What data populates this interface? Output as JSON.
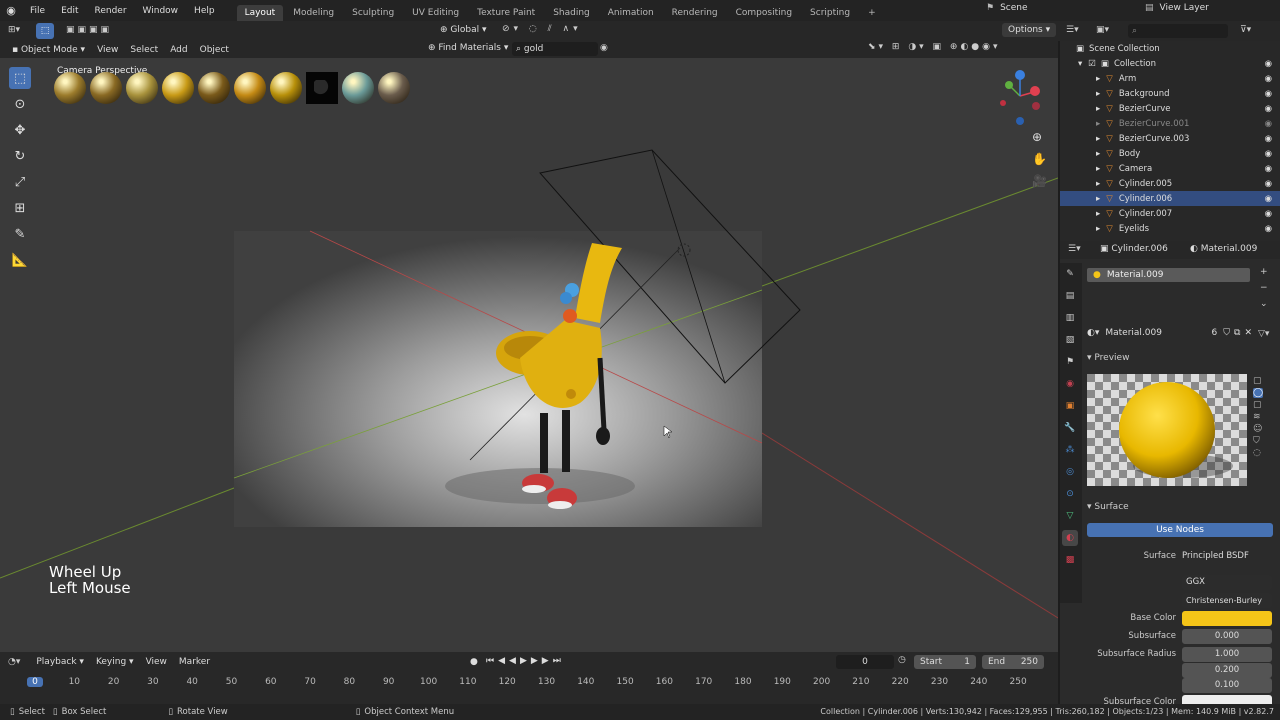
{
  "topbar": {
    "menus": [
      "File",
      "Edit",
      "Render",
      "Window",
      "Help"
    ],
    "tabs": [
      "Layout",
      "Modeling",
      "Sculpting",
      "UV Editing",
      "Texture Paint",
      "Shading",
      "Animation",
      "Rendering",
      "Compositing",
      "Scripting",
      "+"
    ],
    "scene": "Scene",
    "view_layer": "View Layer"
  },
  "viewport_header": {
    "mode": "Object Mode",
    "view": "View",
    "select": "Select",
    "add": "Add",
    "object": "Object",
    "orientation": "Global",
    "options": "Options",
    "find_materials": "Find Materials",
    "search_value": "gold"
  },
  "viewport": {
    "camera_label": "Camera Perspective",
    "overlay_line1": "Wheel Up",
    "overlay_line2": "Left Mouse",
    "material_colors": [
      "#9c7c2c",
      "#8a6a24",
      "#a8923c",
      "#c89a16",
      "#7a5a1a",
      "#c48a14",
      "#b8900a",
      "#101010",
      "#6a9a98",
      "#6a5c4c"
    ]
  },
  "outliner": {
    "scene_collection": "Scene Collection",
    "collection": "Collection",
    "items": [
      {
        "name": "Arm",
        "selected": false,
        "dim": false
      },
      {
        "name": "Background",
        "selected": false,
        "dim": false
      },
      {
        "name": "BezierCurve",
        "selected": false,
        "dim": false
      },
      {
        "name": "BezierCurve.001",
        "selected": false,
        "dim": true
      },
      {
        "name": "BezierCurve.003",
        "selected": false,
        "dim": false
      },
      {
        "name": "Body",
        "selected": false,
        "dim": false
      },
      {
        "name": "Camera",
        "selected": false,
        "dim": false
      },
      {
        "name": "Cylinder.005",
        "selected": false,
        "dim": false
      },
      {
        "name": "Cylinder.006",
        "selected": true,
        "dim": false
      },
      {
        "name": "Cylinder.007",
        "selected": false,
        "dim": false
      },
      {
        "name": "Eyelids",
        "selected": false,
        "dim": false
      }
    ]
  },
  "properties": {
    "object": "Cylinder.006",
    "material": "Material.009",
    "slot": "Material.009",
    "users": "6",
    "preview_label": "Preview",
    "surface_label": "Surface",
    "use_nodes": "Use Nodes",
    "surface_shader": "Principled BSDF",
    "distribution": "GGX",
    "subsurface_method": "Christensen-Burley",
    "base_color": "#f5c518",
    "base_color_label": "Base Color",
    "subsurface_label": "Subsurface",
    "subsurface_value": "0.000",
    "radius_label": "Subsurface Radius",
    "radius_values": [
      "1.000",
      "0.200",
      "0.100"
    ],
    "ss_color_label": "Subsurface Color",
    "surface_row_label": "Surface"
  },
  "timeline": {
    "menus": [
      "Playback",
      "Keying",
      "View",
      "Marker"
    ],
    "current_frame": "0",
    "start_label": "Start",
    "start": "1",
    "end_label": "End",
    "end": "250",
    "ruler": [
      "0",
      "10",
      "20",
      "30",
      "40",
      "50",
      "60",
      "70",
      "80",
      "90",
      "100",
      "110",
      "120",
      "130",
      "140",
      "150",
      "160",
      "170",
      "180",
      "190",
      "200",
      "210",
      "220",
      "230",
      "240",
      "250"
    ]
  },
  "statusbar": {
    "select": "Select",
    "box_select": "Box Select",
    "rotate_view": "Rotate View",
    "context_menu": "Object Context Menu",
    "stats": "Collection | Cylinder.006 | Verts:130,942 | Faces:129,955 | Tris:260,182 | Objects:1/23 | Mem: 140.9 MiB | v2.82.7"
  }
}
